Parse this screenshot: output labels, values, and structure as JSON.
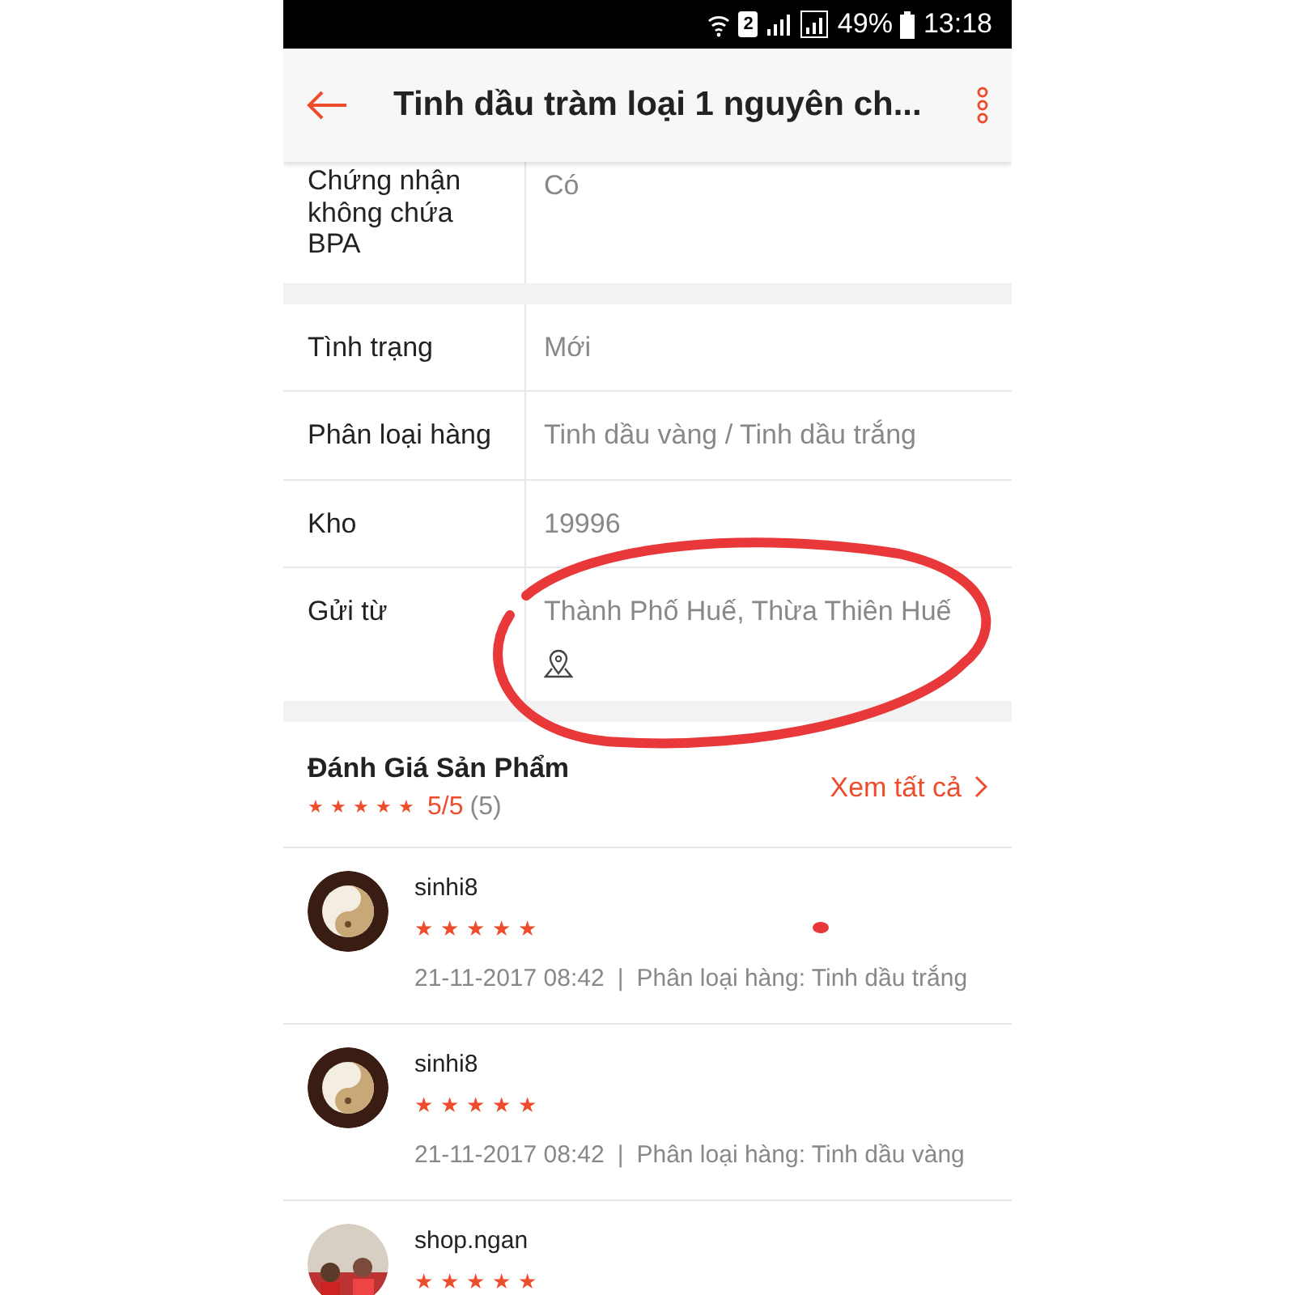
{
  "status_bar": {
    "sim": "2",
    "battery": "49%",
    "time": "13:18"
  },
  "header": {
    "title": "Tinh dầu tràm loại 1 nguyên ch..."
  },
  "spec_groups": [
    [
      {
        "label": "Chứng nhận không chứa BPA",
        "value": "Có"
      }
    ],
    [
      {
        "label": "Tình trạng",
        "value": "Mới"
      },
      {
        "label": "Phân loại hàng",
        "value": "Tinh dầu vàng / Tinh dầu trắng"
      },
      {
        "label": "Kho",
        "value": "19996"
      },
      {
        "label": "Gửi từ",
        "value": "Thành Phố Huế, Thừa Thiên Huế",
        "kind": "location"
      }
    ]
  ],
  "reviews_summary": {
    "title": "Đánh Giá Sản Phẩm",
    "stars": 5,
    "score": "5/5",
    "count": "(5)",
    "see_all": "Xem tất cả"
  },
  "reviews": [
    {
      "user": "sinhi8",
      "stars": 5,
      "time": "21-11-2017 08:42",
      "separator": "|",
      "variant": "Phân loại hàng: Tinh dầu trắng",
      "kind": "picture"
    },
    {
      "user": "sinhi8",
      "stars": 5,
      "time": "21-11-2017 08:42",
      "separator": "|",
      "variant": "Phân loại hàng: Tinh dầu vàng",
      "kind": "picture"
    },
    {
      "user": "shop.ngan",
      "stars": 5,
      "kind": "picture"
    }
  ]
}
